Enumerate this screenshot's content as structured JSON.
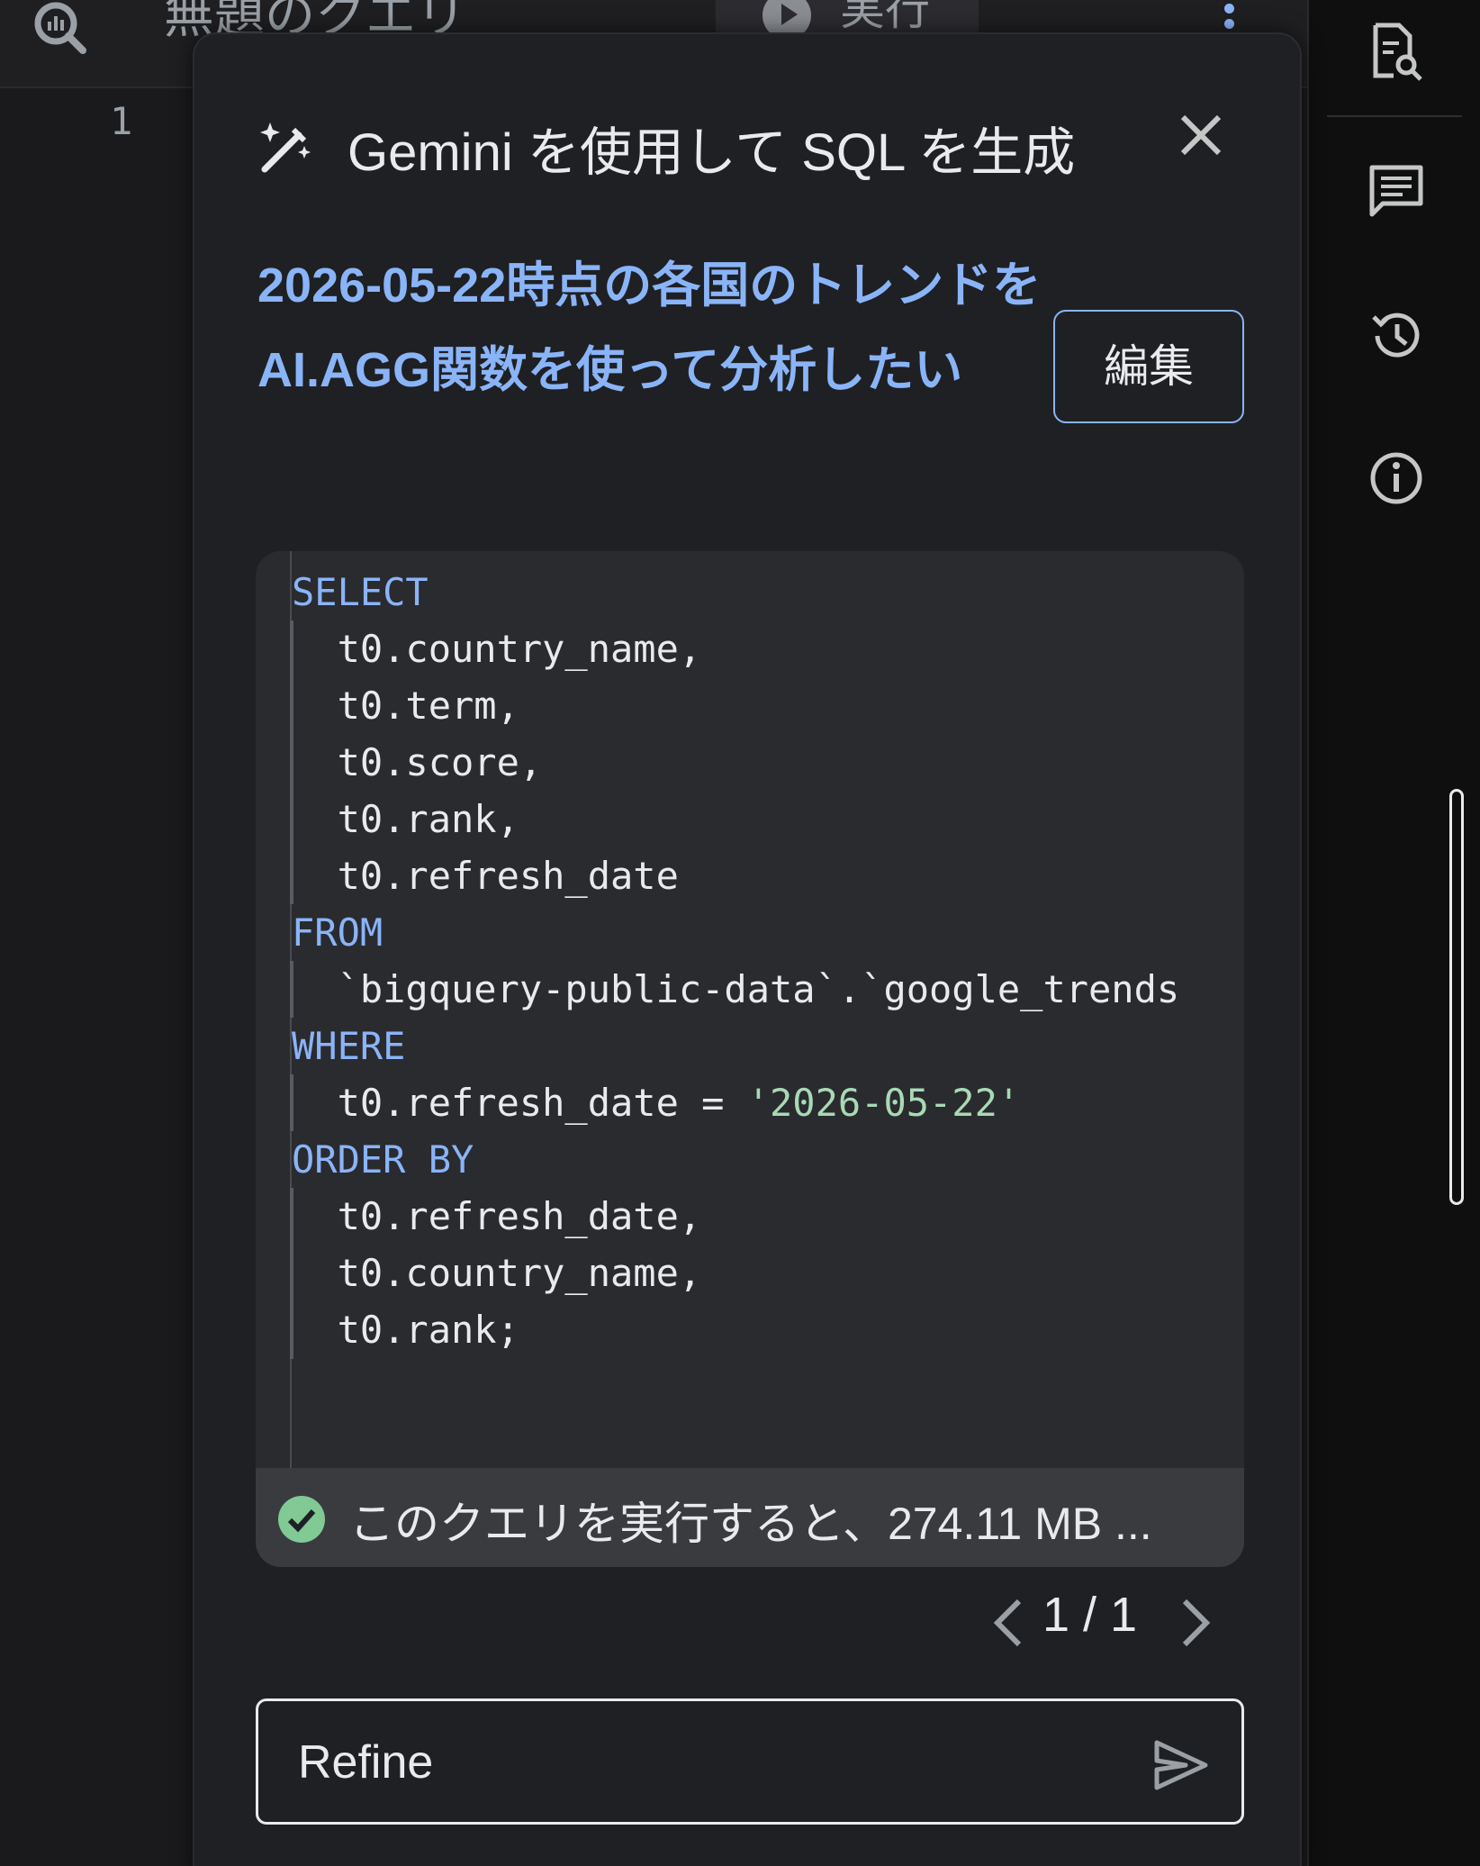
{
  "editor": {
    "tab_title": "無題のクエリ",
    "run_label": "実行",
    "line_number": "1"
  },
  "panel": {
    "title": "Gemini を使用して SQL を生成",
    "prompt": "2026-05-22時点の各国のトレンドをAI.AGG関数を使って分析したい",
    "edit_label": "編集",
    "code_lines": [
      {
        "kw": "SELECT",
        "text": ""
      },
      {
        "kw": "",
        "text": "  t0.country_name,"
      },
      {
        "kw": "",
        "text": "  t0.term,"
      },
      {
        "kw": "",
        "text": "  t0.score,"
      },
      {
        "kw": "",
        "text": "  t0.rank,"
      },
      {
        "kw": "",
        "text": "  t0.refresh_date"
      },
      {
        "kw": "FROM",
        "text": ""
      },
      {
        "kw": "",
        "text": "  `bigquery-public-data`.`google_trends"
      },
      {
        "kw": "WHERE",
        "text": ""
      },
      {
        "kw": "",
        "text": "  t0.refresh_date = ",
        "str": "'2026-05-22'"
      },
      {
        "kw": "ORDER BY",
        "text": ""
      },
      {
        "kw": "",
        "text": "  t0.refresh_date,"
      },
      {
        "kw": "",
        "text": "  t0.country_name,"
      },
      {
        "kw": "",
        "text": "  t0.rank;"
      }
    ],
    "status_text": "このクエリを実行すると、274.11 MB ...",
    "pager_label": "1 / 1",
    "refine_placeholder": "Refine"
  },
  "colors": {
    "accent": "#8ab4f8",
    "string": "#a8dab5",
    "success": "#81c995"
  },
  "icons": [
    "bigquery-icon",
    "more-vert-icon",
    "query-inspect-icon",
    "comment-icon",
    "history-icon",
    "info-icon",
    "sparkle-pen-icon",
    "close-icon",
    "check-circle-icon",
    "chevron-left-icon",
    "chevron-right-icon",
    "send-icon",
    "play-icon"
  ]
}
